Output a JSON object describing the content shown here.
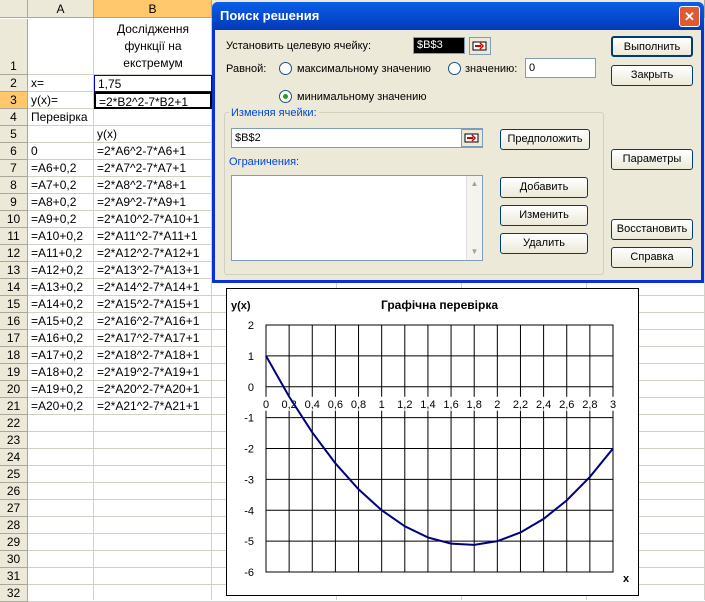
{
  "sheet": {
    "col_headers": [
      "A",
      "B"
    ],
    "row_numbers": [
      "1",
      "2",
      "3",
      "4",
      "5",
      "6",
      "7",
      "8",
      "9",
      "10",
      "11",
      "12",
      "13",
      "14",
      "15",
      "16",
      "17",
      "18",
      "19",
      "20",
      "21",
      "22",
      "23",
      "24",
      "25",
      "26",
      "27",
      "28",
      "29",
      "30",
      "31",
      "32"
    ],
    "b1_title_lines": [
      "Дослідження",
      "функції на",
      "екстремум"
    ],
    "a2": "x=",
    "b2": "1,75",
    "a3": "y(x)=",
    "b3": "=2*B2^2-7*B2+1",
    "a4": "Перевірка",
    "b5": "y(x)",
    "table_a": [
      "0",
      "=A6+0,2",
      "=A7+0,2",
      "=A8+0,2",
      "=A9+0,2",
      "=A10+0,2",
      "=A11+0,2",
      "=A12+0,2",
      "=A13+0,2",
      "=A14+0,2",
      "=A15+0,2",
      "=A16+0,2",
      "=A17+0,2",
      "=A18+0,2",
      "=A19+0,2",
      "=A20+0,2"
    ],
    "table_b": [
      "=2*A6^2-7*A6+1",
      "=2*A7^2-7*A7+1",
      "=2*A8^2-7*A8+1",
      "=2*A9^2-7*A9+1",
      "=2*A10^2-7*A10+1",
      "=2*A11^2-7*A11+1",
      "=2*A12^2-7*A12+1",
      "=2*A13^2-7*A13+1",
      "=2*A14^2-7*A14+1",
      "=2*A15^2-7*A15+1",
      "=2*A16^2-7*A16+1",
      "=2*A17^2-7*A17+1",
      "=2*A18^2-7*A18+1",
      "=2*A19^2-7*A19+1",
      "=2*A20^2-7*A20+1",
      "=2*A21^2-7*A21+1"
    ]
  },
  "dialog": {
    "title": "Поиск решения",
    "close_glyph": "✕",
    "target_label": "Установить целевую ячейку:",
    "target_value": "$B$3",
    "equal_label": "Равной:",
    "max_label": "максимальному значению",
    "value_label": "значению:",
    "value_input": "0",
    "min_label": "минимальному значению",
    "changing_label": "Изменяя ячейки:",
    "changing_value": "$B$2",
    "guess_button": "Предположить",
    "constraints_label": "Ограничения:",
    "add_button": "Добавить",
    "change_button": "Изменить",
    "delete_button": "Удалить",
    "solve_button": "Выполнить",
    "close_button": "Закрыть",
    "options_button": "Параметры",
    "reset_button": "Восстановить",
    "help_button": "Справка"
  },
  "chart_data": {
    "type": "line",
    "title": "Графічна перевірка",
    "ylabel": "y(x)",
    "xlabel": "x",
    "x": [
      0,
      0.2,
      0.4,
      0.6,
      0.8,
      1,
      1.2,
      1.4,
      1.6,
      1.8,
      2,
      2.2,
      2.4,
      2.6,
      2.8,
      3
    ],
    "x_tick_labels": [
      "0",
      "0,2",
      "0,4",
      "0,6",
      "0,8",
      "1",
      "1,2",
      "1,4",
      "1,6",
      "1,8",
      "2",
      "2,2",
      "2,4",
      "2,6",
      "2,8",
      "3"
    ],
    "y": [
      1,
      -0.32,
      -1.48,
      -2.48,
      -3.32,
      -4,
      -4.52,
      -4.88,
      -5.08,
      -5.12,
      -5,
      -4.72,
      -4.28,
      -3.68,
      -2.92,
      -2
    ],
    "y_tick_labels": [
      "2",
      "1",
      "0",
      "-1",
      "-2",
      "-3",
      "-4",
      "-5",
      "-6"
    ],
    "ylim": [
      -6,
      2
    ],
    "grid": true,
    "line_color": "#000080"
  }
}
